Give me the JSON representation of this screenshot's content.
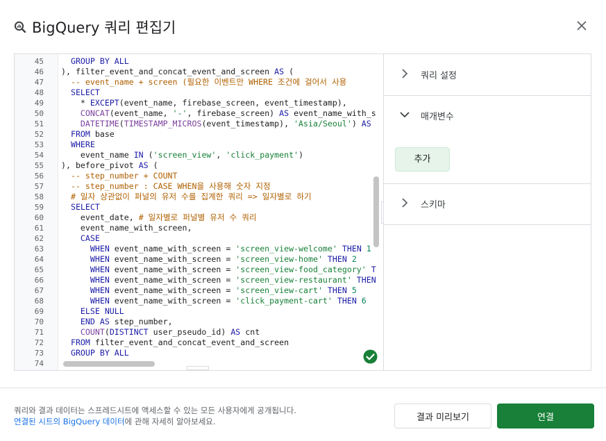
{
  "dialog": {
    "title": "BigQuery 쿼리 편집기",
    "logo_icon": "bigquery-icon",
    "close_icon": "close-icon"
  },
  "editor": {
    "lines": [
      {
        "num": "45",
        "tokens": [
          {
            "t": "  GROUP BY ALL",
            "c": "kw"
          }
        ]
      },
      {
        "num": "46",
        "tokens": [
          {
            "t": "), filter_event_and_concat_event_and_screen ",
            "c": "tx"
          },
          {
            "t": "AS",
            "c": "kw"
          },
          {
            "t": " (",
            "c": "tx"
          }
        ]
      },
      {
        "num": "47",
        "tokens": [
          {
            "t": "  -- event_name + screen (필요한 이벤트만 WHERE 조건에 걸어서 사용",
            "c": "com"
          }
        ]
      },
      {
        "num": "48",
        "tokens": [
          {
            "t": "  SELECT",
            "c": "kw"
          }
        ]
      },
      {
        "num": "49",
        "tokens": [
          {
            "t": "    * ",
            "c": "tx"
          },
          {
            "t": "EXCEPT",
            "c": "kw"
          },
          {
            "t": "(event_name, firebase_screen, event_timestamp),",
            "c": "tx"
          }
        ]
      },
      {
        "num": "50",
        "tokens": [
          {
            "t": "    ",
            "c": "tx"
          },
          {
            "t": "CONCAT",
            "c": "fn"
          },
          {
            "t": "(event_name, ",
            "c": "tx"
          },
          {
            "t": "'-'",
            "c": "str"
          },
          {
            "t": ", firebase_screen) ",
            "c": "tx"
          },
          {
            "t": "AS",
            "c": "kw"
          },
          {
            "t": " event_name_with_s",
            "c": "tx"
          }
        ]
      },
      {
        "num": "51",
        "tokens": [
          {
            "t": "    ",
            "c": "tx"
          },
          {
            "t": "DATETIME",
            "c": "fn"
          },
          {
            "t": "(",
            "c": "tx"
          },
          {
            "t": "TIMESTAMP_MICROS",
            "c": "fn"
          },
          {
            "t": "(event_timestamp), ",
            "c": "tx"
          },
          {
            "t": "'Asia/Seoul'",
            "c": "str"
          },
          {
            "t": ") ",
            "c": "tx"
          },
          {
            "t": "AS",
            "c": "kw"
          }
        ]
      },
      {
        "num": "52",
        "tokens": [
          {
            "t": "  FROM",
            "c": "kw"
          },
          {
            "t": " base",
            "c": "tx"
          }
        ]
      },
      {
        "num": "53",
        "tokens": [
          {
            "t": "  WHERE",
            "c": "kw"
          }
        ]
      },
      {
        "num": "54",
        "tokens": [
          {
            "t": "    event_name ",
            "c": "tx"
          },
          {
            "t": "IN",
            "c": "kw"
          },
          {
            "t": " (",
            "c": "tx"
          },
          {
            "t": "'screen_view'",
            "c": "str"
          },
          {
            "t": ", ",
            "c": "tx"
          },
          {
            "t": "'click_payment'",
            "c": "str"
          },
          {
            "t": ")",
            "c": "tx"
          }
        ]
      },
      {
        "num": "55",
        "tokens": [
          {
            "t": "), before_pivot ",
            "c": "tx"
          },
          {
            "t": "AS",
            "c": "kw"
          },
          {
            "t": " (",
            "c": "tx"
          }
        ]
      },
      {
        "num": "56",
        "tokens": [
          {
            "t": "  -- step_number + COUNT",
            "c": "com"
          }
        ]
      },
      {
        "num": "57",
        "tokens": [
          {
            "t": "  -- step_number : CASE WHEN을 사용해 숫자 지정",
            "c": "com"
          }
        ]
      },
      {
        "num": "58",
        "tokens": [
          {
            "t": "  # 일자 상관없이 퍼널의 유저 수를 집계한 쿼리 => 일자별로 하기 ",
            "c": "com"
          }
        ]
      },
      {
        "num": "59",
        "tokens": [
          {
            "t": "  SELECT",
            "c": "kw"
          }
        ]
      },
      {
        "num": "60",
        "tokens": [
          {
            "t": "    event_date, ",
            "c": "tx"
          },
          {
            "t": "# 일자별로 퍼널별 유저 수 쿼리",
            "c": "com"
          }
        ]
      },
      {
        "num": "61",
        "tokens": [
          {
            "t": "    event_name_with_screen,",
            "c": "tx"
          }
        ]
      },
      {
        "num": "62",
        "tokens": [
          {
            "t": "    CASE",
            "c": "kw"
          }
        ]
      },
      {
        "num": "63",
        "tokens": [
          {
            "t": "      WHEN",
            "c": "kw"
          },
          {
            "t": " event_name_with_screen = ",
            "c": "tx"
          },
          {
            "t": "'screen_view-welcome'",
            "c": "str"
          },
          {
            "t": " ",
            "c": "tx"
          },
          {
            "t": "THEN",
            "c": "kw"
          },
          {
            "t": " 1",
            "c": "num"
          }
        ]
      },
      {
        "num": "64",
        "tokens": [
          {
            "t": "      WHEN",
            "c": "kw"
          },
          {
            "t": " event_name_with_screen = ",
            "c": "tx"
          },
          {
            "t": "'screen_view-home'",
            "c": "str"
          },
          {
            "t": " ",
            "c": "tx"
          },
          {
            "t": "THEN",
            "c": "kw"
          },
          {
            "t": " 2",
            "c": "num"
          }
        ]
      },
      {
        "num": "65",
        "tokens": [
          {
            "t": "      WHEN",
            "c": "kw"
          },
          {
            "t": " event_name_with_screen = ",
            "c": "tx"
          },
          {
            "t": "'screen_view-food_category'",
            "c": "str"
          },
          {
            "t": " T",
            "c": "kw"
          }
        ]
      },
      {
        "num": "66",
        "tokens": [
          {
            "t": "      WHEN",
            "c": "kw"
          },
          {
            "t": " event_name_with_screen = ",
            "c": "tx"
          },
          {
            "t": "'screen_view-restaurant'",
            "c": "str"
          },
          {
            "t": " THEN",
            "c": "kw"
          }
        ]
      },
      {
        "num": "67",
        "tokens": [
          {
            "t": "      WHEN",
            "c": "kw"
          },
          {
            "t": " event_name_with_screen = ",
            "c": "tx"
          },
          {
            "t": "'screen_view-cart'",
            "c": "str"
          },
          {
            "t": " ",
            "c": "tx"
          },
          {
            "t": "THEN",
            "c": "kw"
          },
          {
            "t": " 5",
            "c": "num"
          }
        ]
      },
      {
        "num": "68",
        "tokens": [
          {
            "t": "      WHEN",
            "c": "kw"
          },
          {
            "t": " event_name_with_screen = ",
            "c": "tx"
          },
          {
            "t": "'click_payment-cart'",
            "c": "str"
          },
          {
            "t": " ",
            "c": "tx"
          },
          {
            "t": "THEN",
            "c": "kw"
          },
          {
            "t": " 6",
            "c": "num"
          }
        ]
      },
      {
        "num": "69",
        "tokens": [
          {
            "t": "    ELSE NULL",
            "c": "kw"
          }
        ]
      },
      {
        "num": "70",
        "tokens": [
          {
            "t": "    END AS",
            "c": "kw"
          },
          {
            "t": " step_number,",
            "c": "tx"
          }
        ]
      },
      {
        "num": "71",
        "tokens": [
          {
            "t": "    ",
            "c": "tx"
          },
          {
            "t": "COUNT",
            "c": "fn"
          },
          {
            "t": "(",
            "c": "tx"
          },
          {
            "t": "DISTINCT",
            "c": "kw"
          },
          {
            "t": " user_pseudo_id) ",
            "c": "tx"
          },
          {
            "t": "AS",
            "c": "kw"
          },
          {
            "t": " cnt",
            "c": "tx"
          }
        ]
      },
      {
        "num": "72",
        "tokens": [
          {
            "t": "  FROM",
            "c": "kw"
          },
          {
            "t": " filter_event_and_concat_event_and_screen",
            "c": "tx"
          }
        ]
      },
      {
        "num": "73",
        "tokens": [
          {
            "t": "  GROUP BY ALL",
            "c": "kw"
          }
        ]
      },
      {
        "num": "74",
        "tokens": []
      }
    ],
    "colors": {
      "kw": "#1a1aa6",
      "fn": "#7a3e9d",
      "str": "#188038",
      "com": "#b06000",
      "num": "#098658",
      "tx": "#202124"
    },
    "status_icon": "check-circle-icon"
  },
  "side_panel": {
    "query_settings": {
      "label": "쿼리 설정",
      "icon": "chevron-right-icon",
      "expanded": false
    },
    "parameters": {
      "label": "매개변수",
      "icon": "chevron-down-icon",
      "expanded": true
    },
    "add_button": "추가",
    "schema": {
      "label": "스키마",
      "icon": "chevron-right-icon",
      "expanded": false
    }
  },
  "footer": {
    "notice_line1": "쿼리와 결과 데이터는 스프레드시트에 액세스할 수 있는 모든 사용자에게 공개됩니다.",
    "notice_link": "연결된 시트의 BigQuery 데이터",
    "notice_line2_rest": "에 관해 자세히 알아보세요.",
    "preview_button": "결과 미리보기",
    "connect_button": "연결"
  },
  "colors": {
    "accent_green": "#188038",
    "link_blue": "#1a73e8"
  }
}
